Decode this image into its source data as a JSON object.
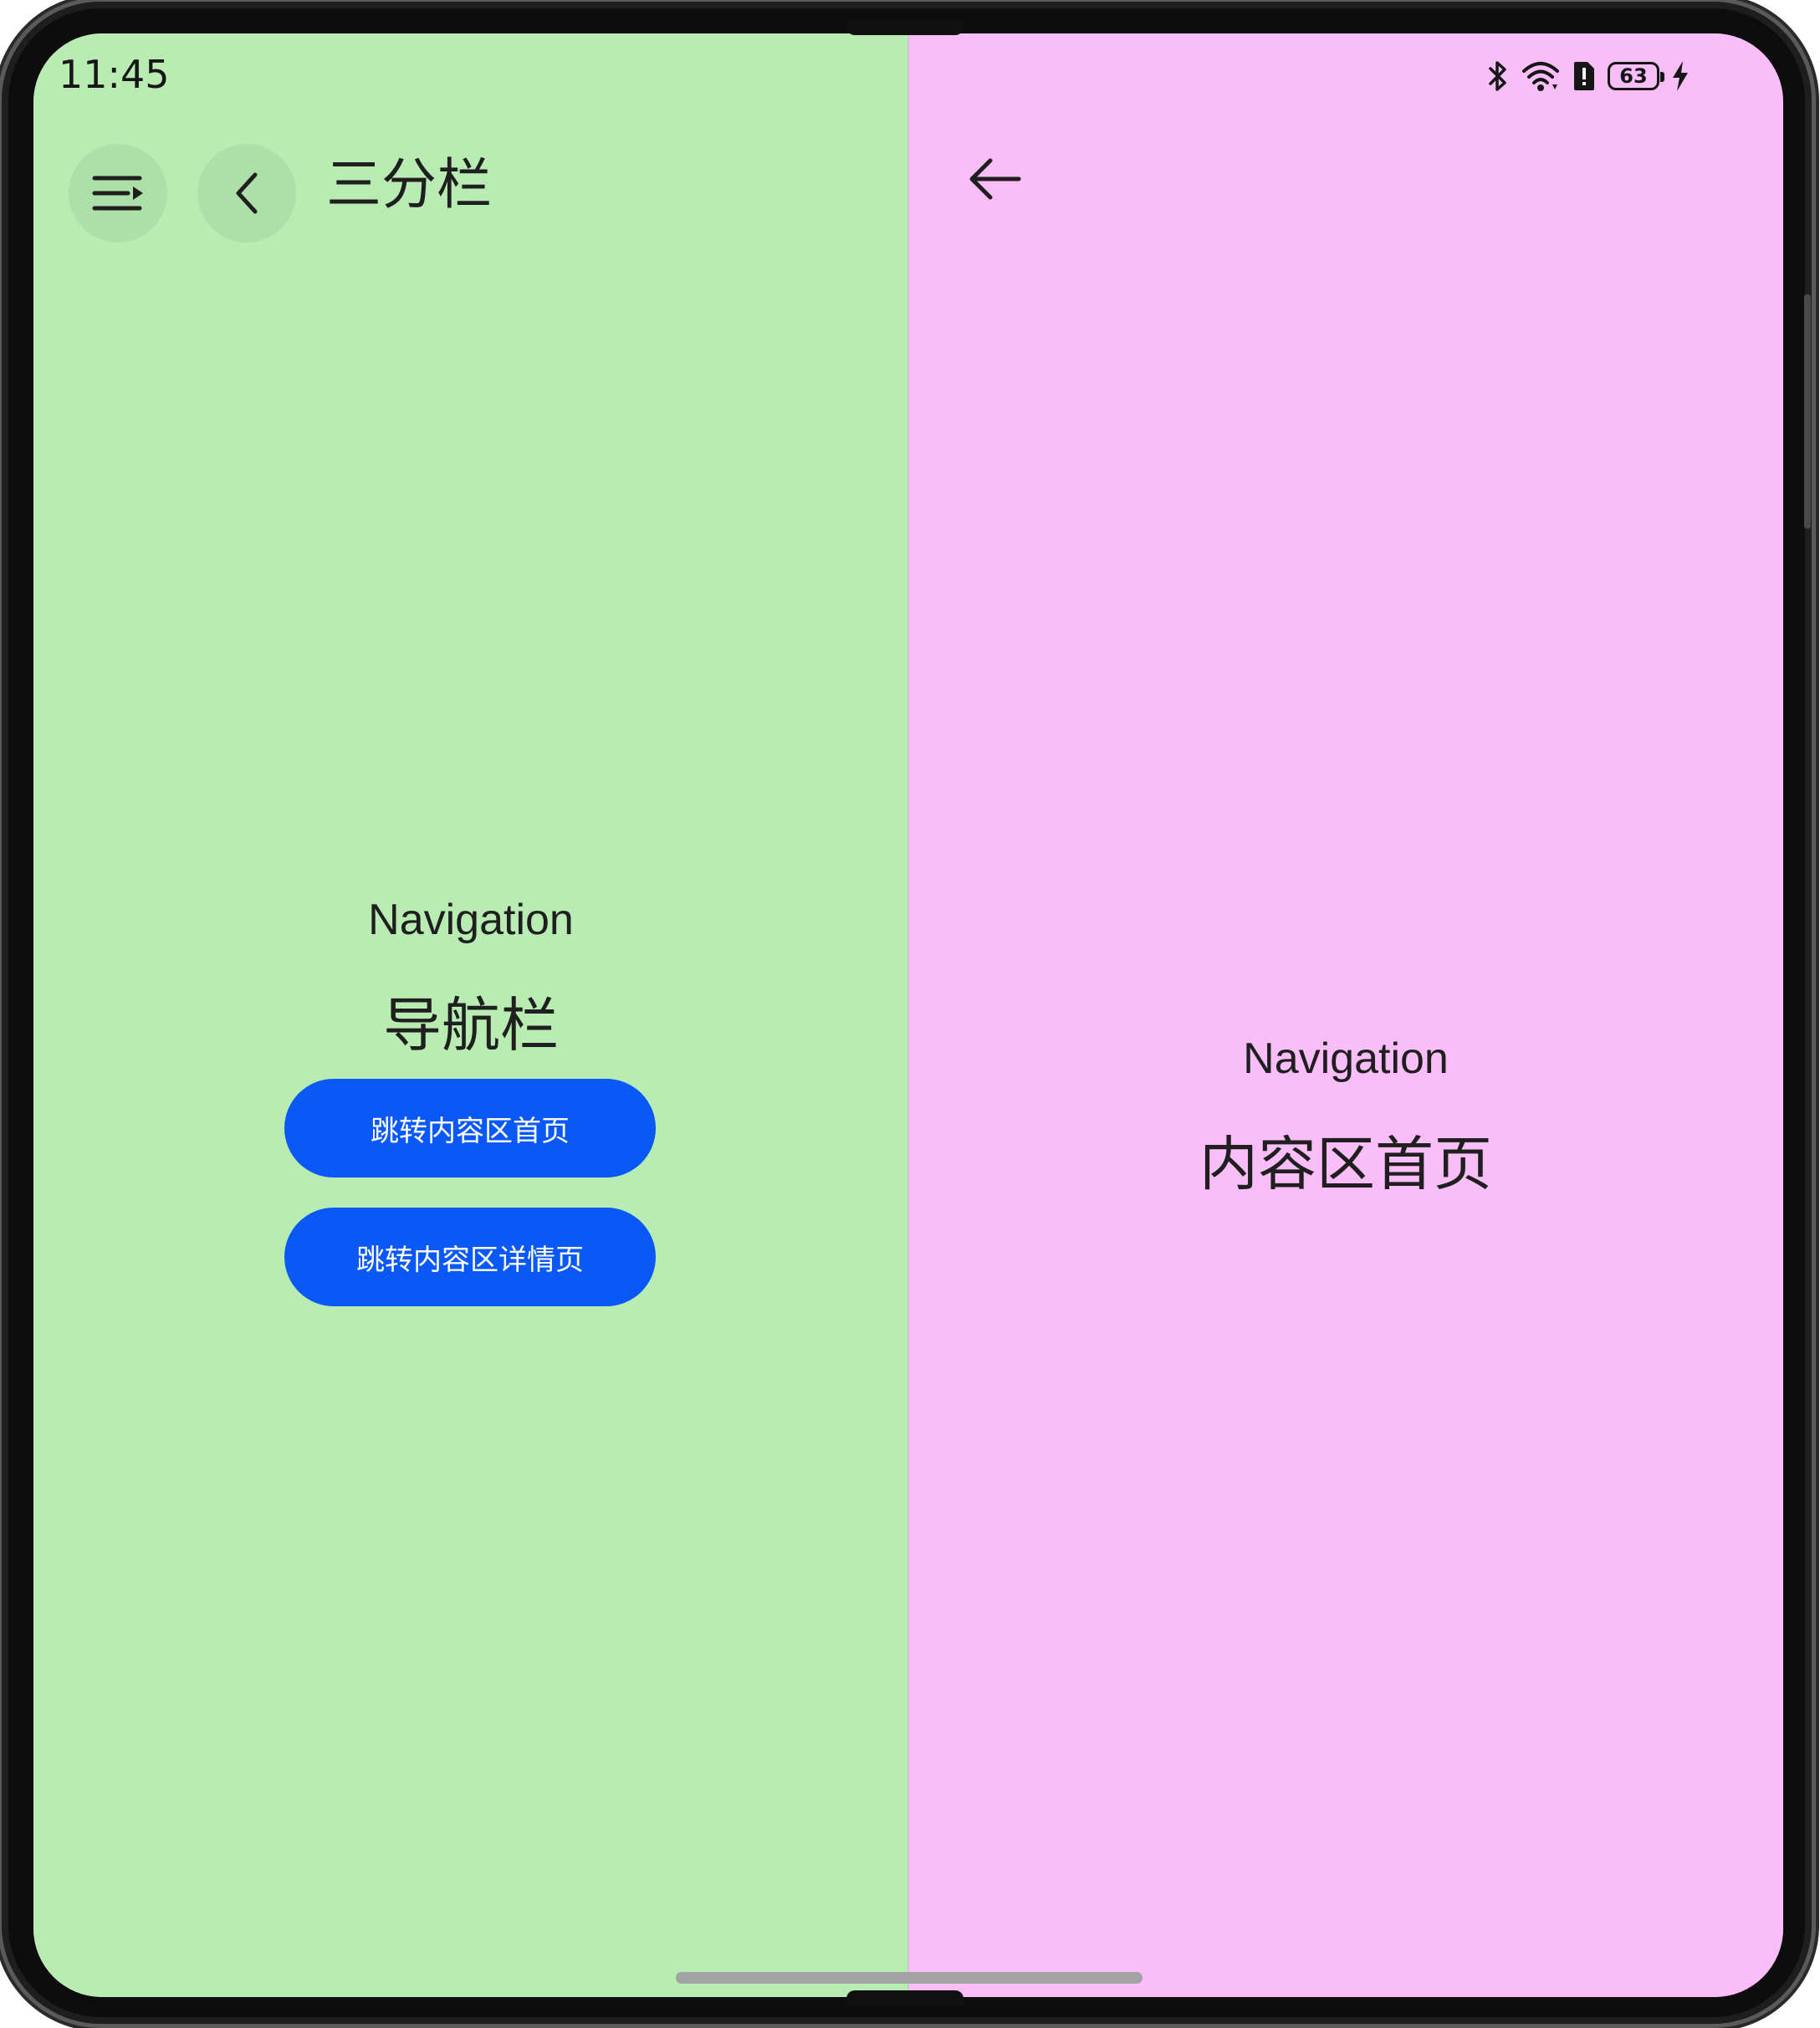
{
  "status_bar": {
    "time": "11:45",
    "battery_level": "63",
    "icons": [
      "bluetooth-icon",
      "wifi-icon",
      "sim-alert-icon",
      "battery-icon",
      "charging-icon"
    ]
  },
  "nav_pane": {
    "title": "三分栏",
    "menu_icon": "menu-expand-icon",
    "back_icon": "chevron-left-icon",
    "subtitle": "Navigation",
    "heading": "导航栏",
    "buttons": [
      {
        "label": "跳转内容区首页"
      },
      {
        "label": "跳转内容区详情页"
      }
    ],
    "background": "#b8ecb2"
  },
  "content_pane": {
    "back_icon": "arrow-left-icon",
    "subtitle": "Navigation",
    "heading": "内容区首页",
    "background": "#f9bdf7"
  },
  "colors": {
    "accent": "#0a59f7",
    "text": "#1f1f1f"
  }
}
